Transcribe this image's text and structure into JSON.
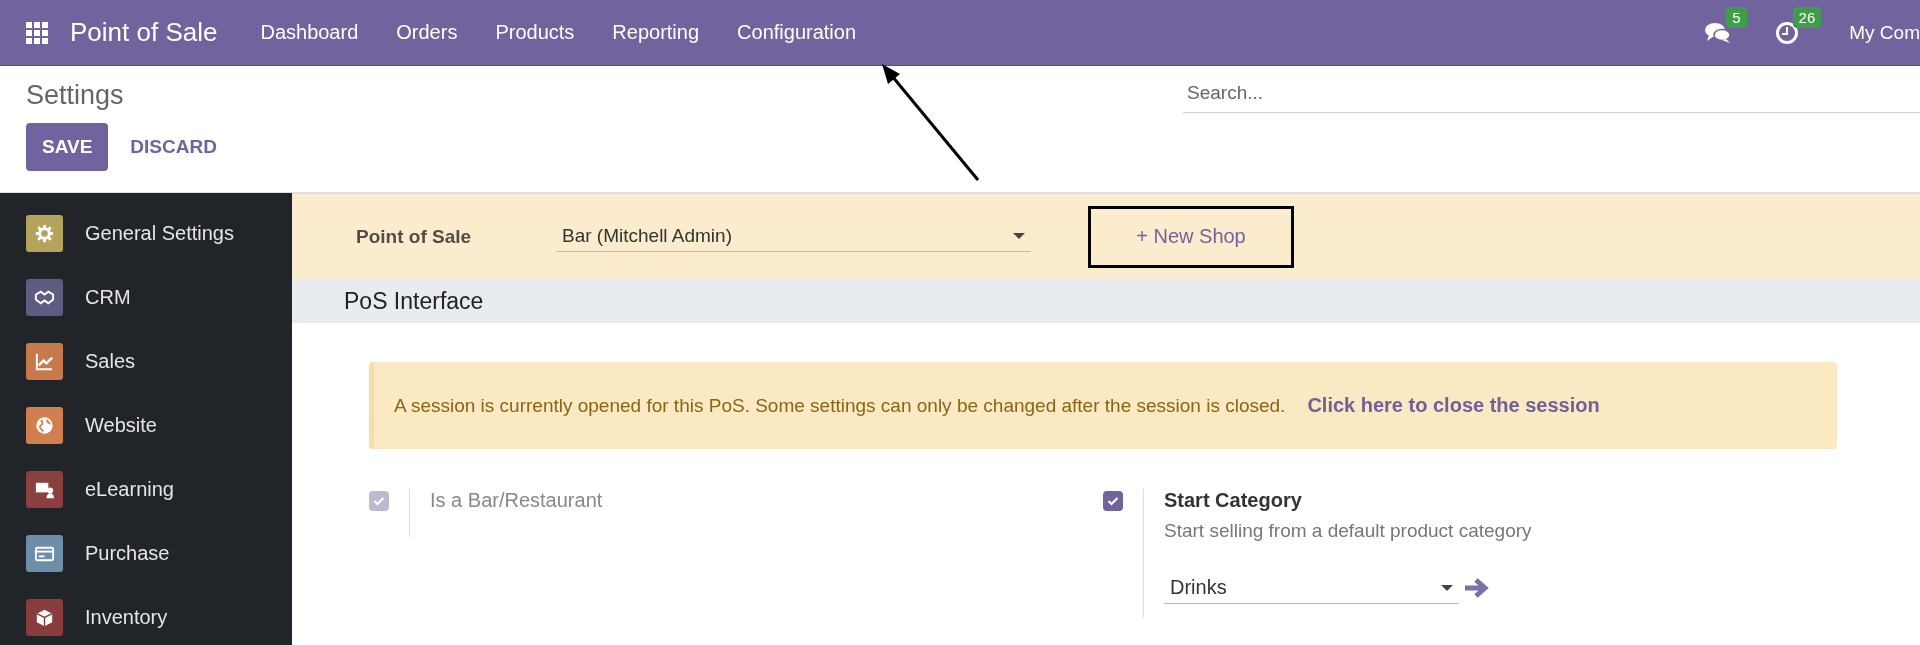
{
  "navbar": {
    "app_title": "Point of Sale",
    "menu": [
      "Dashboard",
      "Orders",
      "Products",
      "Reporting",
      "Configuration"
    ],
    "messages_count": "5",
    "activities_count": "26",
    "company": "My Com"
  },
  "control_panel": {
    "title": "Settings",
    "search": {
      "placeholder": "Search..."
    },
    "buttons": [
      {
        "label": "SAVE",
        "kind": "primary"
      },
      {
        "label": "DISCARD",
        "kind": "secondary"
      }
    ]
  },
  "sidebar": {
    "items": [
      {
        "label": "General Settings",
        "kind": "gear",
        "color": "#b5a35c"
      },
      {
        "label": "CRM",
        "kind": "handshake",
        "color": "#5e5c80"
      },
      {
        "label": "Sales",
        "kind": "chart",
        "color": "#c8794a"
      },
      {
        "label": "Website",
        "kind": "globe",
        "color": "#d27f4f"
      },
      {
        "label": "eLearning",
        "kind": "presentation",
        "color": "#8c3f3f"
      },
      {
        "label": "Purchase",
        "kind": "card",
        "color": "#6d8ea8"
      },
      {
        "label": "Inventory",
        "kind": "box",
        "color": "#8a3c3c"
      }
    ]
  },
  "pos_selector": {
    "label": "Point of Sale",
    "value": "Bar (Mitchell Admin)",
    "new_shop": "+ New Shop"
  },
  "section": {
    "title": "PoS Interface"
  },
  "alert": {
    "text": "A session is currently opened for this PoS. Some settings can only be changed after the session is closed.",
    "link": "Click here to close the session"
  },
  "settings": [
    {
      "label": "Is a Bar/Restaurant",
      "checked": true,
      "disabled": true
    },
    {
      "label": "Start Category",
      "description": "Start selling from a default product category",
      "checked": true,
      "disabled": false,
      "select_value": "Drinks"
    }
  ]
}
